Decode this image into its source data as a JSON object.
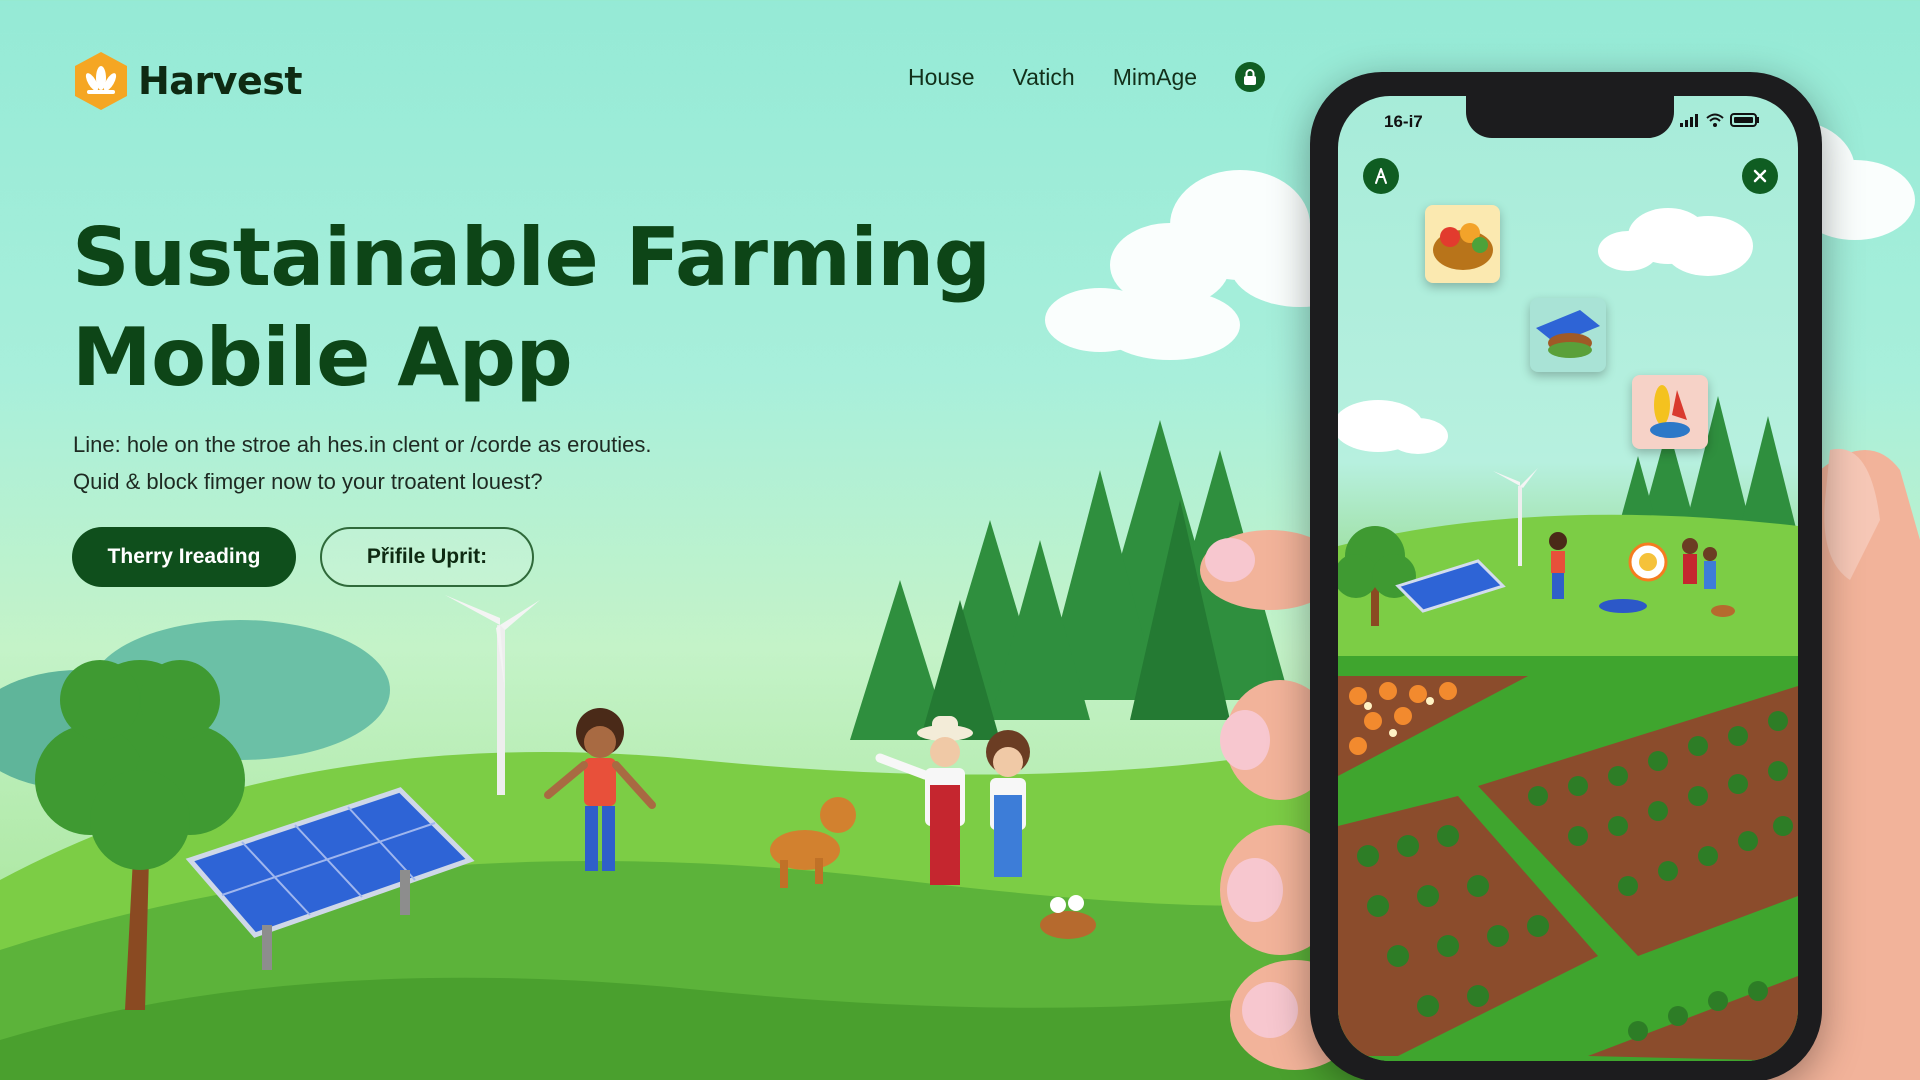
{
  "brand": {
    "name": "Harvest",
    "logo_icon": "lotus-icon"
  },
  "nav": {
    "items": [
      "House",
      "Vatich",
      "MimAge"
    ],
    "action_icon": "lock-icon"
  },
  "hero": {
    "title_line1": "Sustainable Farming",
    "title_line2": "Mobile App",
    "subtitle_line1": "Line: hole on the stroe ah hes.in clent or /corde as erouties.",
    "subtitle_line2": "Quid & block fimger now to your troatent louest?",
    "primary_button": "Therry Ireading",
    "secondary_button": "Přifile Uprit:"
  },
  "phone": {
    "status_time": "16-i7",
    "status_icons": [
      "signal-icon",
      "wifi-icon",
      "battery-icon"
    ],
    "top_left_icon": "compass-icon",
    "top_right_icon": "close-icon",
    "cards": [
      "food-basket-card",
      "solar-burger-card",
      "corn-bowl-card"
    ]
  },
  "colors": {
    "brand_dark_green": "#0d4517",
    "button_green": "#0f4f1c",
    "logo_orange": "#f5a623",
    "background_mint": "#95ead6"
  }
}
